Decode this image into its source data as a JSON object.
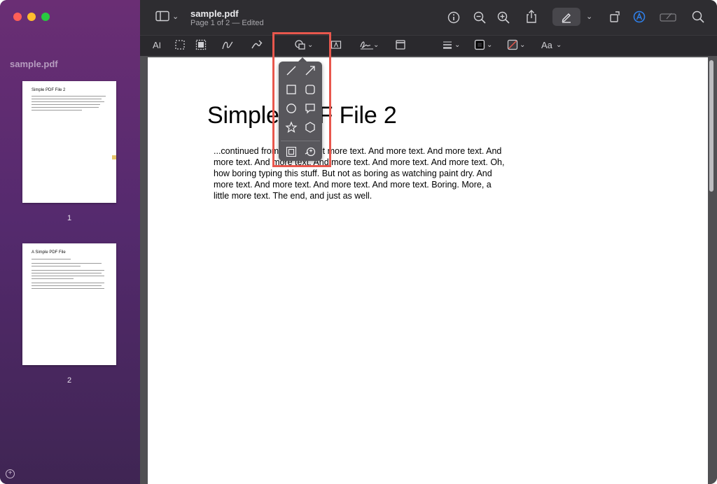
{
  "window": {
    "title": "sample.pdf",
    "subtitle": "Page 1 of 2 — Edited"
  },
  "sidebar": {
    "title": "sample.pdf",
    "pages": [
      {
        "number": "1",
        "heading": "Simple PDF File 2"
      },
      {
        "number": "2",
        "heading": "A Simple PDF File"
      }
    ]
  },
  "toolbar": {
    "markup_font_label": "Aa"
  },
  "document": {
    "heading": "Simple PDF File 2",
    "body": "...continued from page 1. Yet more text. And more text. And more text. And more text. And more text. And more text. And more text. And more text. Oh, how boring typing this stuff. But not as boring as watching paint dry. And more text. And more text. And more text. And more text. Boring.  More, a little more text. The end, and just as well."
  },
  "shapes_popover": {
    "items": [
      "line",
      "arrow",
      "rectangle",
      "rounded-rectangle",
      "oval",
      "speech-bubble",
      "star",
      "hexagon",
      "mask",
      "loupe"
    ]
  },
  "colors": {
    "highlight": "#e8574d",
    "sidebar": "#6a2e74",
    "toolbar": "#2e2d31"
  }
}
